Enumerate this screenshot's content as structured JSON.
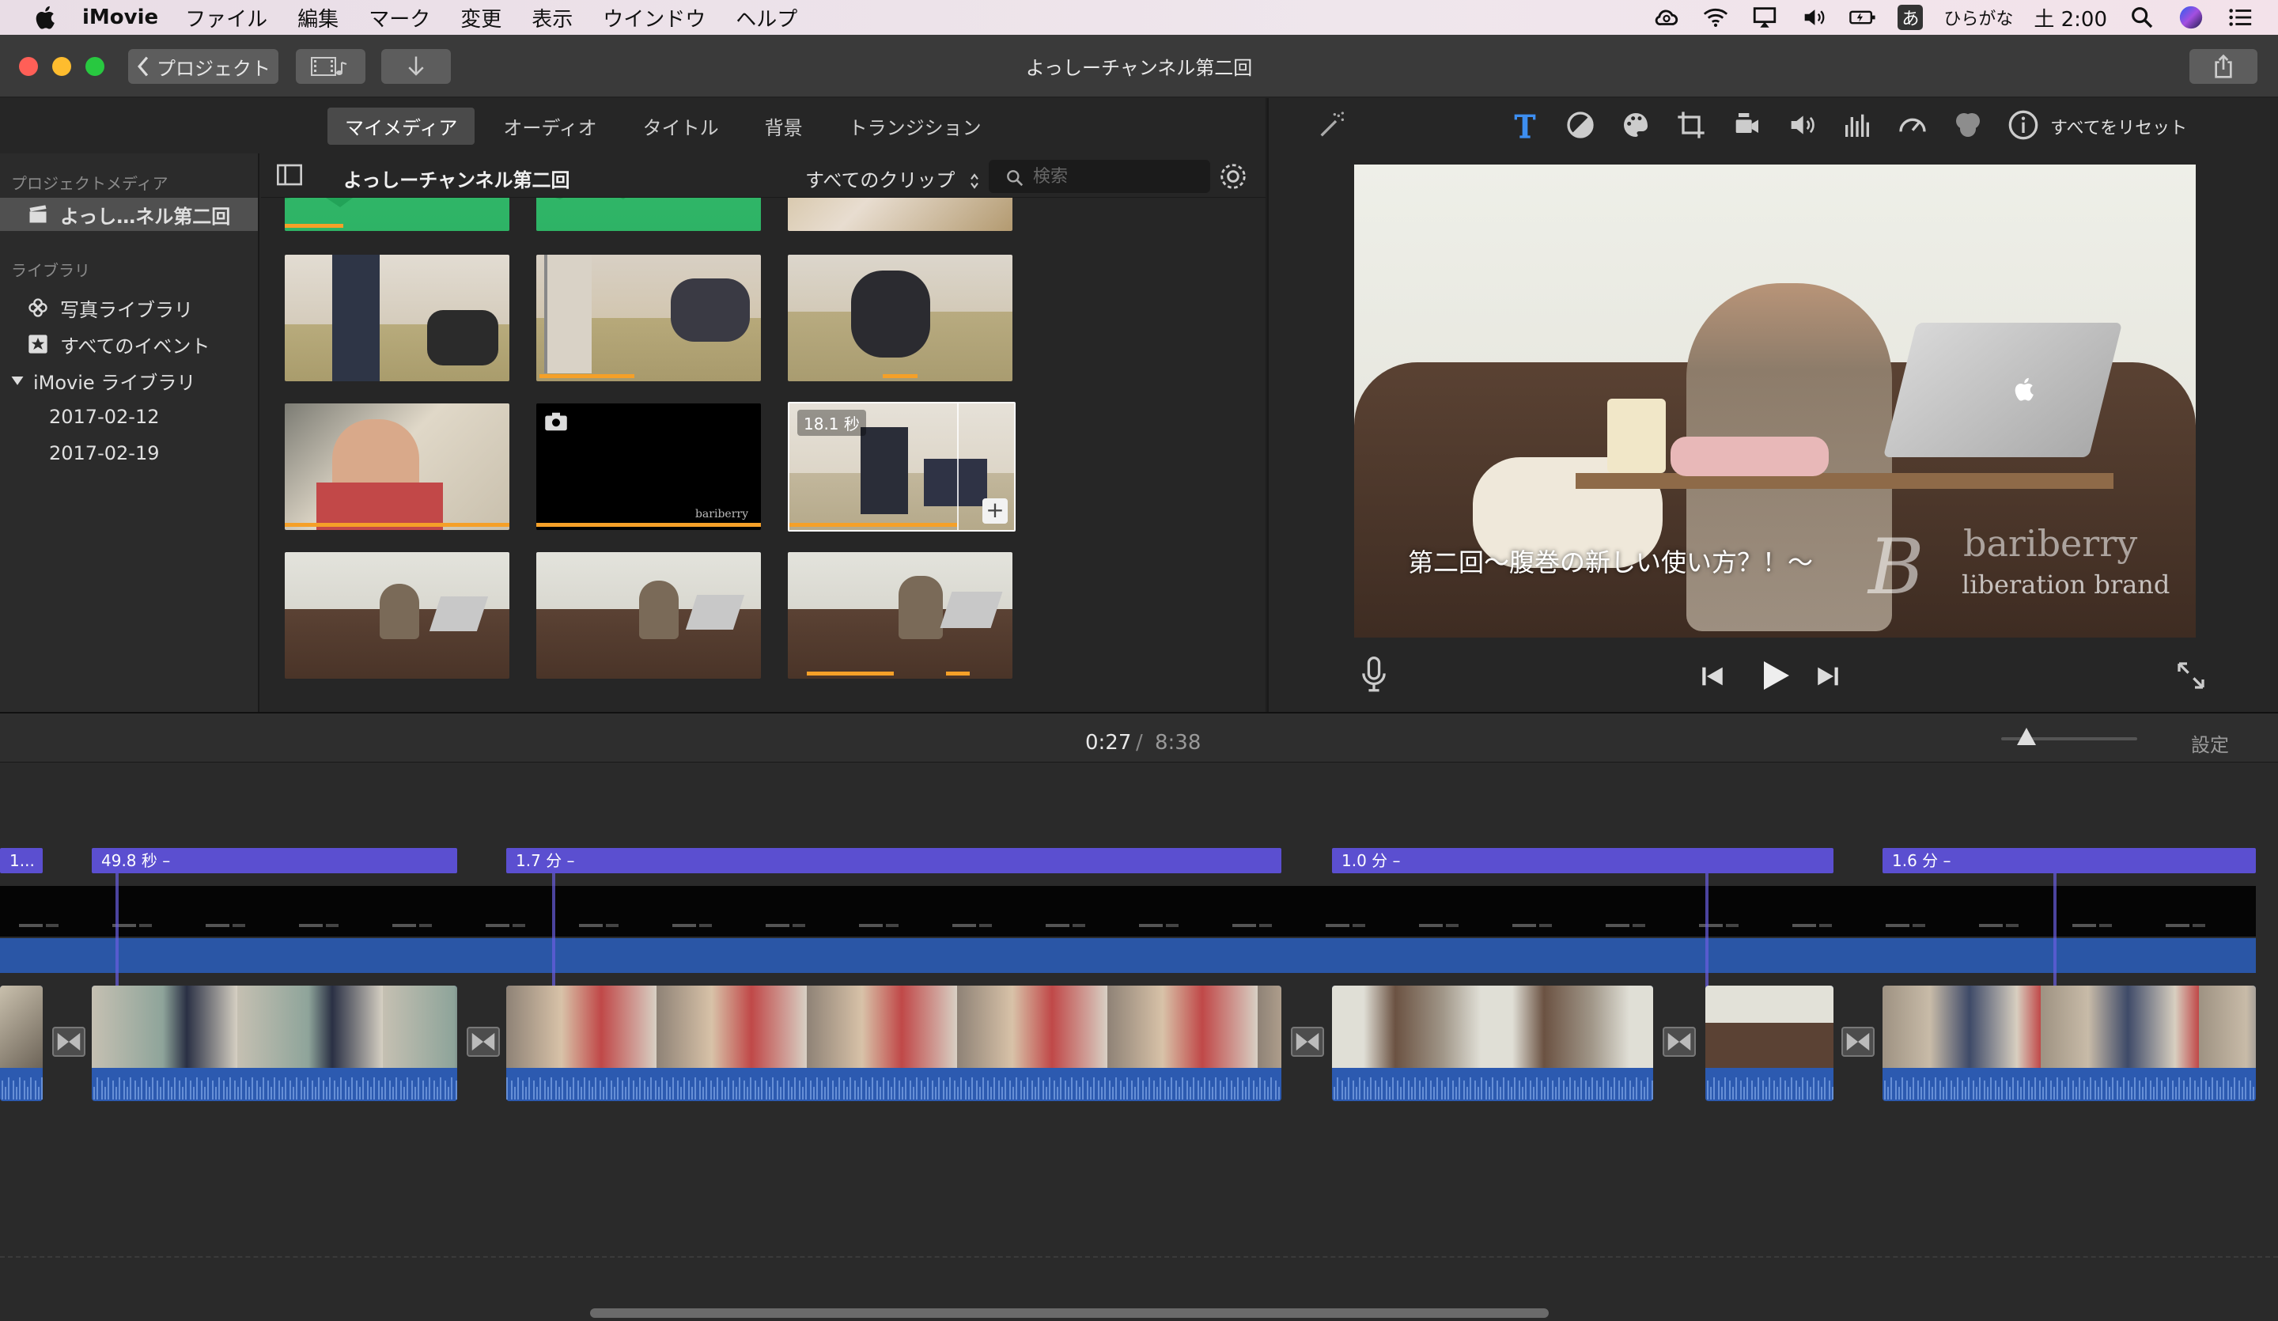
{
  "menubar": {
    "app": "iMovie",
    "items": [
      "ファイル",
      "編集",
      "マーク",
      "変更",
      "表示",
      "ウインドウ",
      "ヘルプ"
    ],
    "input_method": "ひらがな",
    "ime_badge": "あ",
    "clock": "土 2:00",
    "icons": [
      "apple-icon",
      "creative-cloud-icon",
      "wifi-icon",
      "airplay-icon",
      "volume-icon",
      "battery-icon",
      "spotlight-icon",
      "siri-icon",
      "notification-center-icon"
    ]
  },
  "toolbar": {
    "back_label": "プロジェクト",
    "window_title": "よっしーチャンネル第二回"
  },
  "browser": {
    "tabs": [
      "マイメディア",
      "オーディオ",
      "タイトル",
      "背景",
      "トランジション"
    ],
    "active_tab": 0,
    "project_name": "よっしーチャンネル第二回",
    "clip_filter": "すべてのクリップ",
    "search_placeholder": "検索",
    "clip_duration_badge": "18.1 秒",
    "watermark_small": "bariberry"
  },
  "sidebar": {
    "project_media_header": "プロジェクトメディア",
    "project_item": "よっし…ネル第二回",
    "library_header": "ライブラリ",
    "items": [
      "写真ライブラリ",
      "すべてのイベント",
      "iMovie ライブラリ"
    ],
    "dates": [
      "2017-02-12",
      "2017-02-19"
    ]
  },
  "viewer": {
    "reset_label": "すべてをリセット",
    "caption": "第二回〜腹巻の新しい使い方？！〜",
    "watermark_line1": "bariberry",
    "watermark_line2": "liberation brand",
    "adjust_icons": [
      "magic-wand-icon",
      "title-icon",
      "color-balance-icon",
      "color-correction-icon",
      "crop-icon",
      "stabilization-icon",
      "volume-icon",
      "equalizer-icon",
      "speed-icon",
      "filter-icon",
      "info-icon"
    ]
  },
  "timeline": {
    "current_time": "0:27",
    "separator": "/",
    "total_time": "8:38",
    "settings_label": "設定",
    "title_clips": [
      "1...",
      "49.8 秒 –",
      "1.7 分 –",
      "1.0 分 –",
      "1.6 分 –"
    ]
  },
  "colors": {
    "title_clip": "#5b4fd0",
    "audio_track": "#2c5ab0",
    "progress_bar": "#f5a028",
    "accent_blue": "#3d8ef0"
  }
}
